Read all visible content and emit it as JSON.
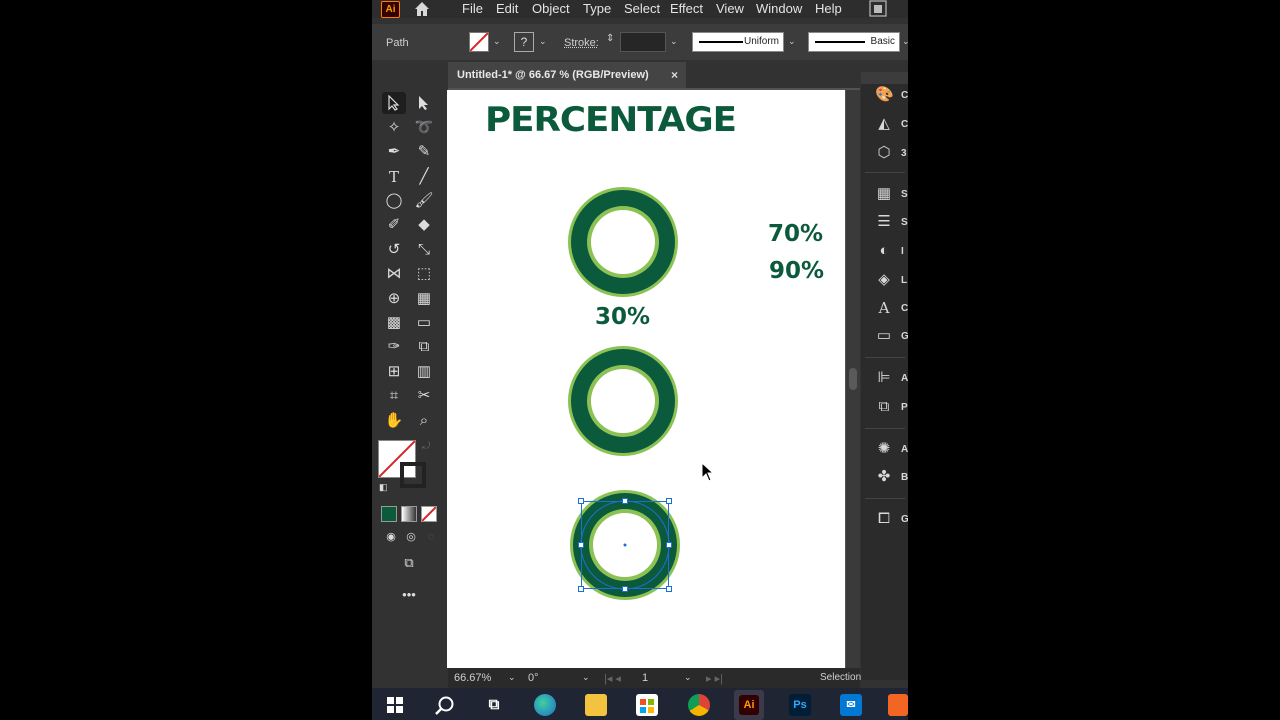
{
  "menu": {
    "logo": "Ai",
    "items": [
      "File",
      "Edit",
      "Object",
      "Type",
      "Select",
      "Effect",
      "View",
      "Window",
      "Help"
    ]
  },
  "control_bar": {
    "selection_type": "Path",
    "fill": "none",
    "stroke_fill": "?",
    "stroke_label": "Stroke:",
    "stroke_weight": "",
    "variable_width_profile": "Uniform",
    "brush": "Basic"
  },
  "document_tab": {
    "title": "Untitled-1* @ 66.67 % (RGB/Preview)",
    "close": "×"
  },
  "artboard": {
    "title": "PERCENTAGE",
    "labels": [
      "30%",
      "70%",
      "90%"
    ],
    "colors": {
      "dark_green": "#0c5a3c",
      "light_green": "#8cc153",
      "selection": "#1b6fd8"
    }
  },
  "status_bar": {
    "zoom": "66.67%",
    "rotation": "0°",
    "artboard_number": "1",
    "tool": "Selection"
  },
  "panels": {
    "items": [
      {
        "icon": "color-icon",
        "label": "C"
      },
      {
        "icon": "color-guide-icon",
        "label": "C"
      },
      {
        "icon": "3d-icon",
        "label": "3"
      },
      {
        "icon": "swatches-icon",
        "label": "S"
      },
      {
        "icon": "stroke-icon",
        "label": "S"
      },
      {
        "icon": "image-trace-icon",
        "label": "I"
      },
      {
        "icon": "layers-icon",
        "label": "L"
      },
      {
        "icon": "character-icon",
        "label": "C"
      },
      {
        "icon": "gradient-icon",
        "label": "G"
      },
      {
        "icon": "align-icon",
        "label": "A"
      },
      {
        "icon": "pathfinder-icon",
        "label": "P"
      },
      {
        "icon": "appearance-icon",
        "label": "A"
      },
      {
        "icon": "brushes-icon",
        "label": "B"
      },
      {
        "icon": "graphic-styles-icon",
        "label": "G"
      }
    ]
  },
  "taskbar": {
    "illustrator_label": "Ai",
    "photoshop_label": "Ps"
  }
}
